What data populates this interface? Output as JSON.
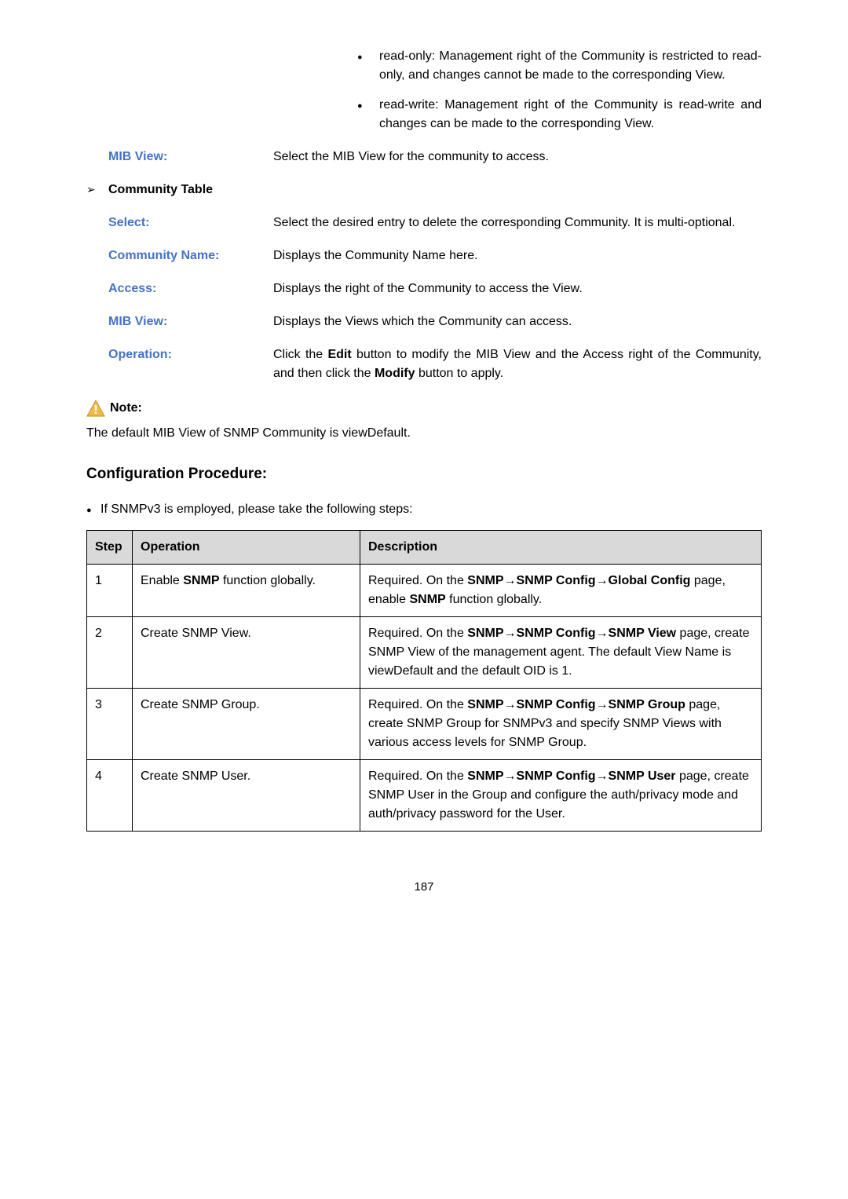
{
  "bullets": {
    "readOnly": "read-only: Management right of the Community is restricted to read-only, and changes cannot be made to the corresponding View.",
    "readWrite": "read-write: Management right of the Community is read-write and changes can be made to the corresponding View."
  },
  "defs": {
    "mibView1": {
      "label": "MIB View:",
      "text": "Select the MIB View for the community to access."
    },
    "communityTable": {
      "arrow": "➢",
      "title": "Community Table"
    },
    "select": {
      "label": "Select:",
      "text": "Select the desired entry to delete the corresponding Community. It is multi-optional."
    },
    "communityName": {
      "label": "Community Name:",
      "text": "Displays the Community Name here."
    },
    "access": {
      "label": "Access:",
      "text": "Displays the right of the Community to access the View."
    },
    "mibView2": {
      "label": "MIB View:",
      "text": "Displays the Views which the Community can access."
    },
    "operation": {
      "label": "Operation:",
      "pre": "Click the ",
      "b1": "Edit",
      "mid": " button to modify the MIB View and the Access right of the Community, and then click the ",
      "b2": "Modify",
      "post": " button to apply."
    }
  },
  "note": {
    "label": "Note:",
    "text": "The default MIB View of SNMP Community is viewDefault."
  },
  "configHeading": "Configuration Procedure:",
  "configIntro": "If SNMPv3 is employed, please take the following steps:",
  "table": {
    "headers": {
      "step": "Step",
      "operation": "Operation",
      "description": "Description"
    },
    "rows": [
      {
        "step": "1",
        "op_pre": "Enable ",
        "op_b": "SNMP",
        "op_post": " function globally.",
        "d_pre": "Required. On the ",
        "d_b1": "SNMP→SNMP Config→Global Config",
        "d_mid": " page, enable ",
        "d_b2": "SNMP",
        "d_post": " function globally."
      },
      {
        "step": "2",
        "op": "Create SNMP View.",
        "d_pre": "Required. On the ",
        "d_b1": "SNMP→SNMP Config→SNMP View",
        "d_post": " page, create SNMP View of the management agent. The default View Name is viewDefault and the default OID is 1."
      },
      {
        "step": "3",
        "op": "Create SNMP Group.",
        "d_pre": "Required. On the ",
        "d_b1": "SNMP→SNMP Config→SNMP Group",
        "d_post": " page, create SNMP Group for SNMPv3 and specify SNMP Views with various access levels for SNMP Group."
      },
      {
        "step": "4",
        "op": "Create SNMP User.",
        "d_pre": "Required. On the ",
        "d_b1": "SNMP→SNMP Config→SNMP User",
        "d_post": " page, create SNMP User in the Group and configure the auth/privacy mode and auth/privacy password for the User."
      }
    ]
  },
  "pageNum": "187"
}
